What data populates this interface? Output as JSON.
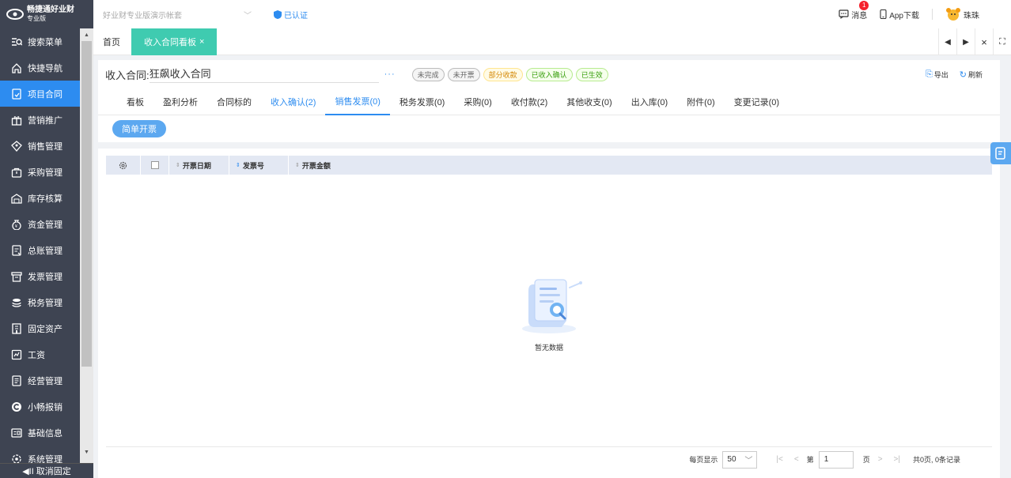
{
  "brand": {
    "name": "畅捷通好业财",
    "edition": "专业版"
  },
  "account": {
    "name": "好业财专业版演示帐套",
    "certified": "已认证"
  },
  "topbar": {
    "messages": "消息",
    "message_count": "1",
    "app_download": "App下载",
    "user": "珠珠"
  },
  "sidebar": {
    "items": [
      {
        "label": "搜索菜单",
        "icon": "search-list-icon"
      },
      {
        "label": "快捷导航",
        "icon": "home-icon"
      },
      {
        "label": "项目合同",
        "icon": "contract-icon",
        "active": true
      },
      {
        "label": "营销推广",
        "icon": "gift-icon"
      },
      {
        "label": "销售管理",
        "icon": "sales-icon"
      },
      {
        "label": "采购管理",
        "icon": "bag-icon"
      },
      {
        "label": "库存核算",
        "icon": "warehouse-icon"
      },
      {
        "label": "资金管理",
        "icon": "money-bag-icon"
      },
      {
        "label": "总账管理",
        "icon": "ledger-icon"
      },
      {
        "label": "发票管理",
        "icon": "invoice-icon"
      },
      {
        "label": "税务管理",
        "icon": "tax-icon"
      },
      {
        "label": "固定资产",
        "icon": "building-icon"
      },
      {
        "label": "工资",
        "icon": "salary-icon"
      },
      {
        "label": "经营管理",
        "icon": "report-icon"
      },
      {
        "label": "小畅报销",
        "icon": "reimburse-icon"
      },
      {
        "label": "基础信息",
        "icon": "info-card-icon"
      },
      {
        "label": "系统管理",
        "icon": "system-icon"
      }
    ],
    "unpin": "取消固定"
  },
  "page_tabs": {
    "home": "首页",
    "current": "收入合同看板",
    "close": "×"
  },
  "header": {
    "contract_label": "收入合同:",
    "contract_name": "狂飙收入合同",
    "more": "···",
    "tags": [
      {
        "label": "未完成",
        "style": "gray"
      },
      {
        "label": "未开票",
        "style": "gray"
      },
      {
        "label": "部分收款",
        "style": "yellow"
      },
      {
        "label": "已收入确认",
        "style": "green"
      },
      {
        "label": "已生效",
        "style": "green"
      }
    ],
    "export": "导出",
    "refresh": "刷新"
  },
  "subtabs": [
    {
      "label": "看板"
    },
    {
      "label": "盈利分析"
    },
    {
      "label": "合同标的"
    },
    {
      "label": "收入确认(2)",
      "blue": true
    },
    {
      "label": "销售发票(0)",
      "active": true
    },
    {
      "label": "税务发票(0)"
    },
    {
      "label": "采购(0)"
    },
    {
      "label": "收付款(2)"
    },
    {
      "label": "其他收支(0)"
    },
    {
      "label": "出入库(0)"
    },
    {
      "label": "附件(0)"
    },
    {
      "label": "变更记录(0)"
    }
  ],
  "toolbar": {
    "simple_invoice": "简单开票"
  },
  "table": {
    "columns": [
      "开票日期",
      "发票号",
      "开票金额"
    ],
    "rows": []
  },
  "empty": {
    "text": "暂无数据"
  },
  "pager": {
    "per_page_label": "每页显示",
    "per_page": "50",
    "page_prefix": "第",
    "page": "1",
    "page_suffix": "页",
    "summary": "共0页, 0条记录"
  },
  "colors": {
    "accent": "#2d8cf0",
    "sidebar_bg": "#3e4452",
    "tab_active": "#3fcbb0"
  }
}
